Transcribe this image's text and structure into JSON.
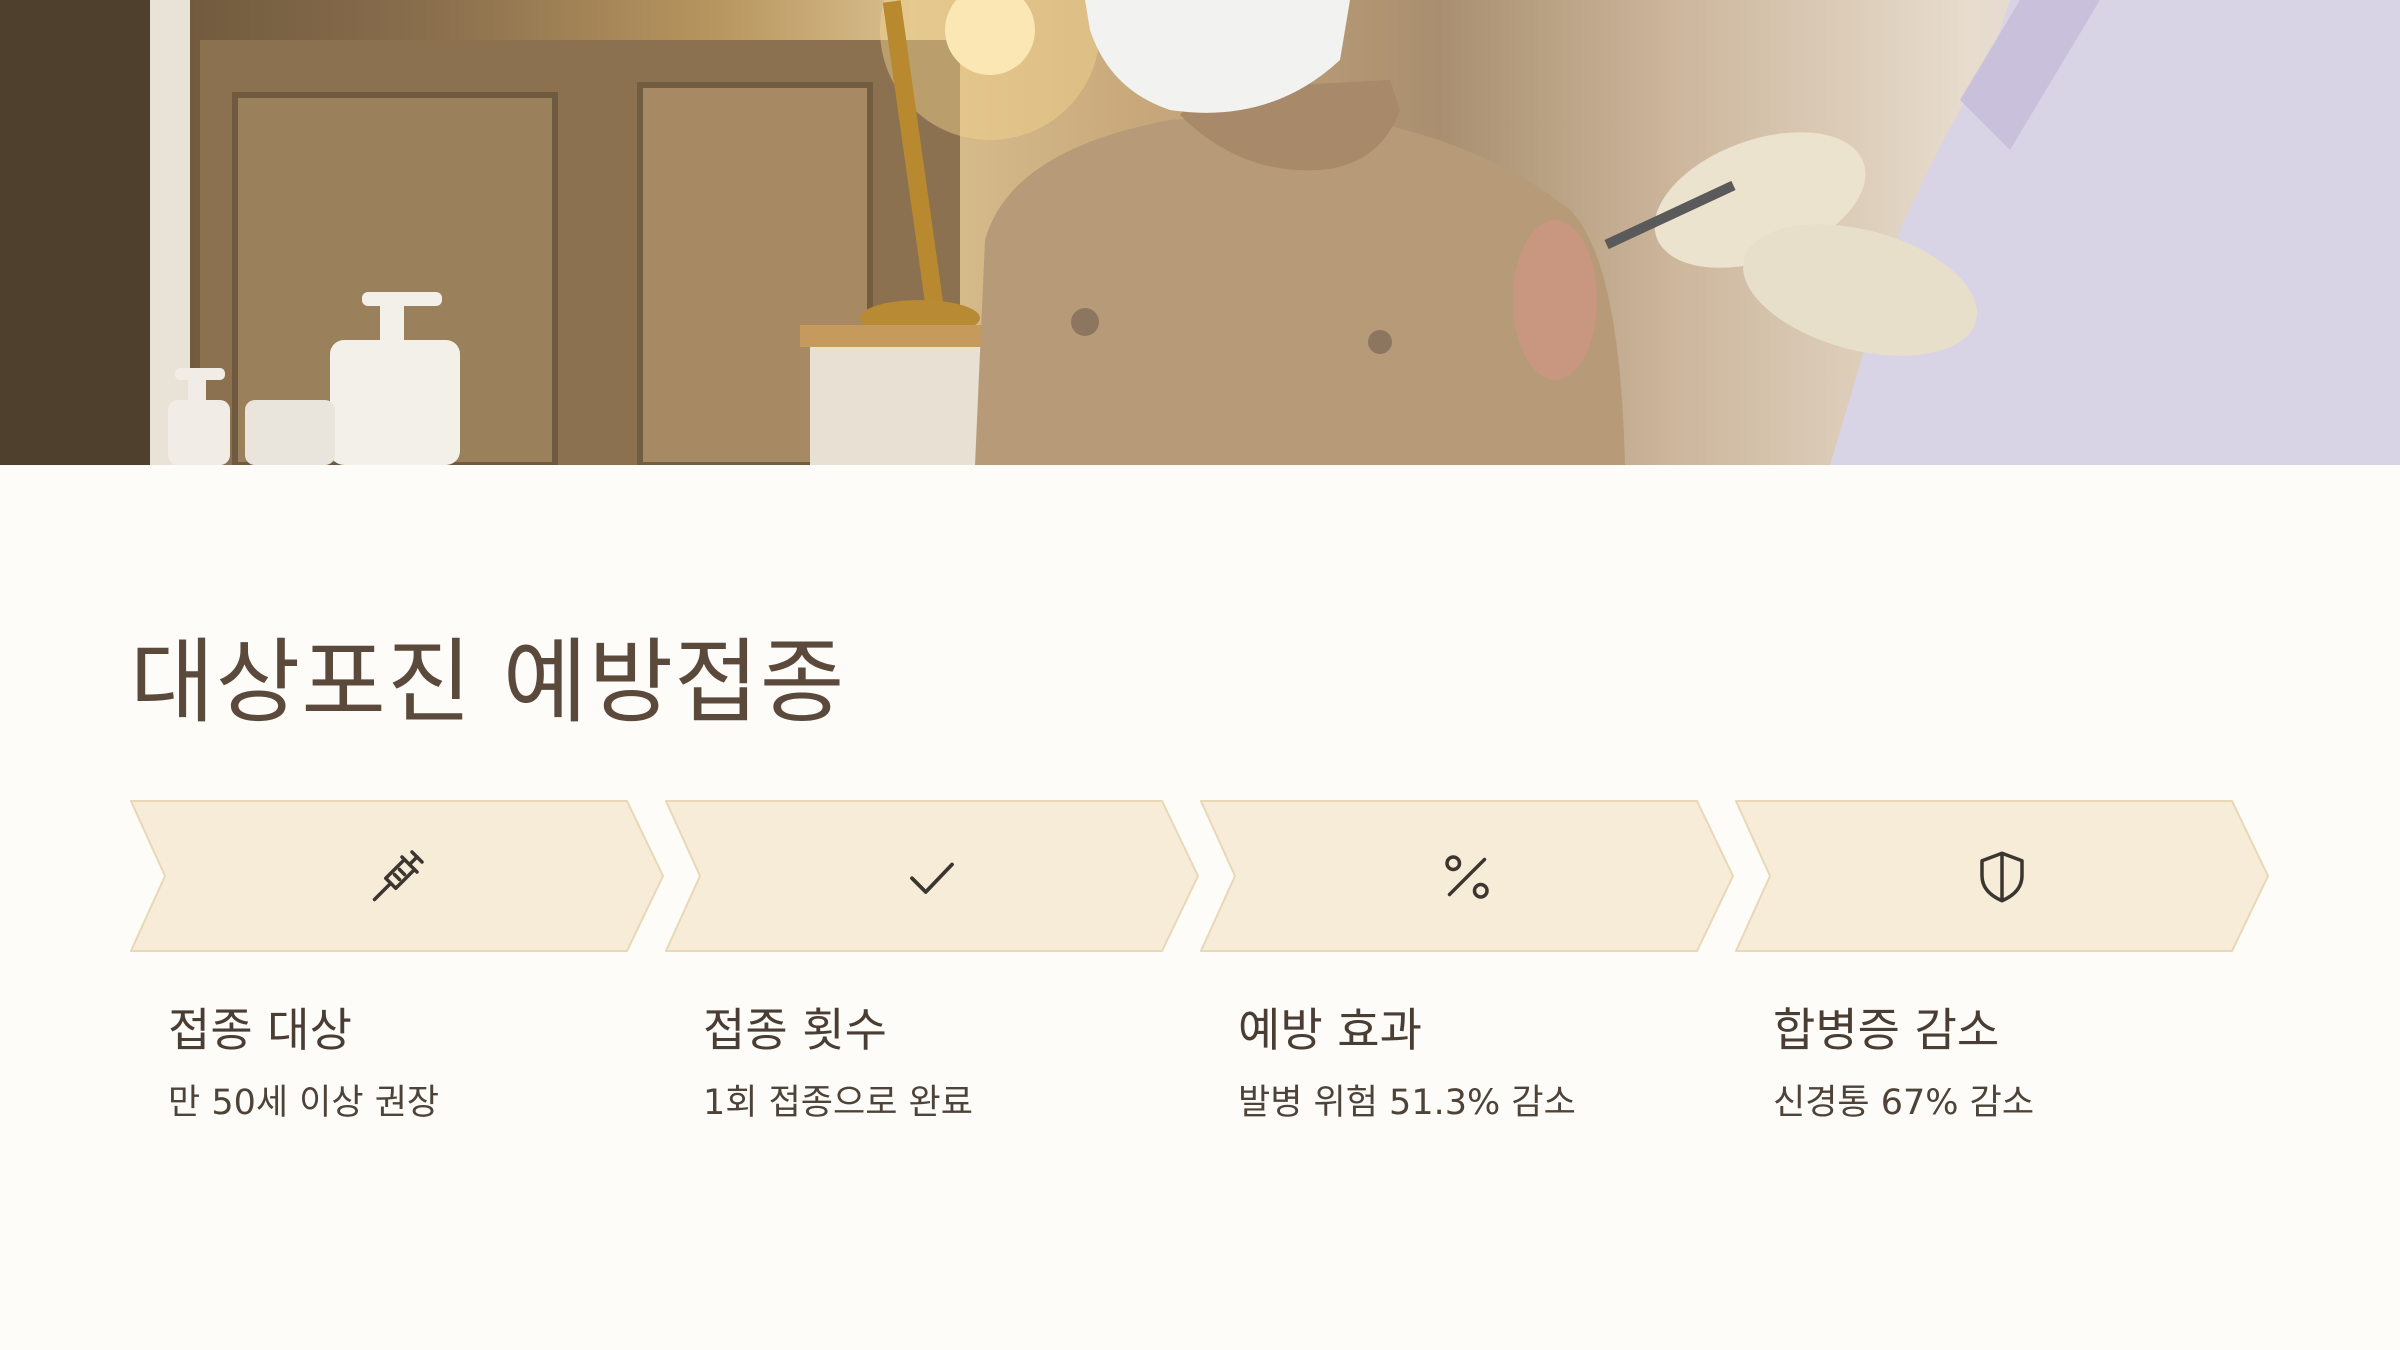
{
  "hero": {
    "alt": ""
  },
  "title": "대상포진 예방접종",
  "steps": [
    {
      "icon": "syringe-icon",
      "title": "접종 대상",
      "desc": "만 50세 이상 권장"
    },
    {
      "icon": "check-icon",
      "title": "접종 횟수",
      "desc": "1회 접종으로 완료"
    },
    {
      "icon": "percent-icon",
      "title": "예방 효과",
      "desc": "발병 위험 51.3% 감소"
    },
    {
      "icon": "shield-icon",
      "title": "합병증 감소",
      "desc": "신경통 67% 감소"
    }
  ],
  "colors": {
    "background": "#fdfcf8",
    "chevron_fill": "#f6ecd7",
    "chevron_stroke": "#e8d8b6",
    "title": "#5b4a3c",
    "icon": "#3c3630"
  }
}
